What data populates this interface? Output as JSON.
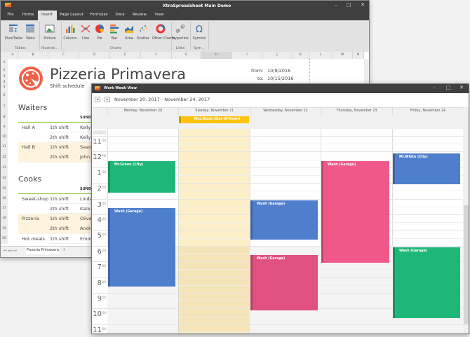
{
  "spreadsheet": {
    "title": "XtraSpreadsheet Main Demo",
    "tabs": [
      "File",
      "Home",
      "Insert",
      "Page Layout",
      "Formulas",
      "Data",
      "Review",
      "View"
    ],
    "active_tab": "Insert",
    "ribbon": {
      "items": [
        {
          "label": "PivotTable",
          "icon": "pivot-table-icon"
        },
        {
          "label": "Table",
          "icon": "table-icon"
        },
        {
          "label": "Picture",
          "icon": "picture-icon"
        },
        {
          "label": "Column",
          "icon": "column-chart-icon"
        },
        {
          "label": "Line",
          "icon": "line-chart-icon"
        },
        {
          "label": "Pie",
          "icon": "pie-chart-icon"
        },
        {
          "label": "Bar",
          "icon": "bar-chart-icon"
        },
        {
          "label": "Area",
          "icon": "area-chart-icon"
        },
        {
          "label": "Scatter",
          "icon": "scatter-chart-icon"
        },
        {
          "label": "Other Charts",
          "icon": "other-charts-icon"
        },
        {
          "label": "Hyperlink",
          "icon": "hyperlink-icon"
        },
        {
          "label": "Symbol",
          "icon": "omega-icon"
        }
      ],
      "groups": [
        "Tables",
        "Illustrat...",
        "Charts",
        "Links",
        "Sym..."
      ]
    },
    "columns": [
      "A",
      "B",
      "C",
      "D",
      "E",
      "F",
      "G",
      "H",
      "I",
      "J",
      "K",
      "L",
      "M",
      "N"
    ],
    "rows": [
      "1",
      "2",
      "3",
      "4",
      "5",
      "6",
      "7",
      "8",
      "9",
      "10",
      "11",
      "12",
      "13",
      "14",
      "15",
      "16",
      "17",
      "18",
      "19",
      "20"
    ],
    "heading": "Pizzeria Primavera",
    "subheading": "Shift schedule",
    "from_label": "from:",
    "from_value": "10/9/2016",
    "to_label": "to:",
    "to_value": "10/15/2016",
    "waiters": {
      "title": "Waiters",
      "col_header": "SUND",
      "rows": [
        {
          "place": "Hall A",
          "shift": "1th shift",
          "name": "Kelly"
        },
        {
          "place": "",
          "shift": "2th shift",
          "name": "Kelly"
        },
        {
          "place": "Hall B",
          "shift": "1th shift",
          "name": "Sean"
        },
        {
          "place": "",
          "shift": "2th shift",
          "name": "John"
        }
      ]
    },
    "cooks": {
      "title": "Cooks",
      "col_header": "SUND",
      "rows": [
        {
          "place": "Sweet-shop",
          "shift": "1th shift",
          "name": "Linda"
        },
        {
          "place": "",
          "shift": "2th shift",
          "name": "Kate"
        },
        {
          "place": "Pizzeria",
          "shift": "1th shift",
          "name": "Olive"
        },
        {
          "place": "",
          "shift": "2th shift",
          "name": "Andre"
        },
        {
          "place": "Hot meals",
          "shift": "1th shift",
          "name": "Emm"
        }
      ]
    },
    "sheet_tab": "Pizzeria Primavera",
    "add_sheet": "+"
  },
  "calendar": {
    "title": "Work Week View",
    "range": "November 20, 2017 - November 24, 2017",
    "days": [
      "Monday, November 20",
      "Tuesday, November 21",
      "Wednesday, November 22",
      "Thursday, November 23",
      "Friday, November 24"
    ],
    "all_day": [
      {
        "day": 1,
        "subject": "Mrs.Black (Out-Of-Town)",
        "color": "#ffc20e"
      }
    ],
    "hours": [
      {
        "n": "11",
        "m": "00"
      },
      {
        "n": "12",
        "m": "PM"
      },
      {
        "n": "1",
        "m": "00"
      },
      {
        "n": "2",
        "m": "00"
      },
      {
        "n": "3",
        "m": "00"
      },
      {
        "n": "4",
        "m": "00"
      },
      {
        "n": "5",
        "m": "00"
      },
      {
        "n": "6",
        "m": "00"
      },
      {
        "n": "7",
        "m": "00"
      },
      {
        "n": "8",
        "m": "00"
      },
      {
        "n": "9",
        "m": "00"
      },
      {
        "n": "10",
        "m": "00"
      },
      {
        "n": "11",
        "m": "00"
      }
    ],
    "more_label": "...",
    "appointments": [
      {
        "day": 0,
        "start": 12.6,
        "end": 14.6,
        "subject": "Mr.Green (City)",
        "color": "#1fb777"
      },
      {
        "day": 0,
        "start": 15.6,
        "end": 20.6,
        "subject": "Wash (Garage)",
        "color": "#4f7fcc"
      },
      {
        "day": 2,
        "start": 15.1,
        "end": 17.6,
        "subject": "Wash (Garage)",
        "color": "#4f7fcc"
      },
      {
        "day": 2,
        "start": 18.6,
        "end": 22.1,
        "subject": "Wash (Garage)",
        "color": "#e05080"
      },
      {
        "day": 3,
        "start": 12.6,
        "end": 19.1,
        "subject": "Wash (Garage)",
        "color": "#f0588a"
      },
      {
        "day": 4,
        "start": 12.1,
        "end": 14.1,
        "subject": "Mr.White (City)",
        "color": "#4f7fcc"
      },
      {
        "day": 4,
        "start": 18.1,
        "end": 22.6,
        "subject": "Wash (Garage)",
        "color": "#1fb777"
      }
    ]
  }
}
